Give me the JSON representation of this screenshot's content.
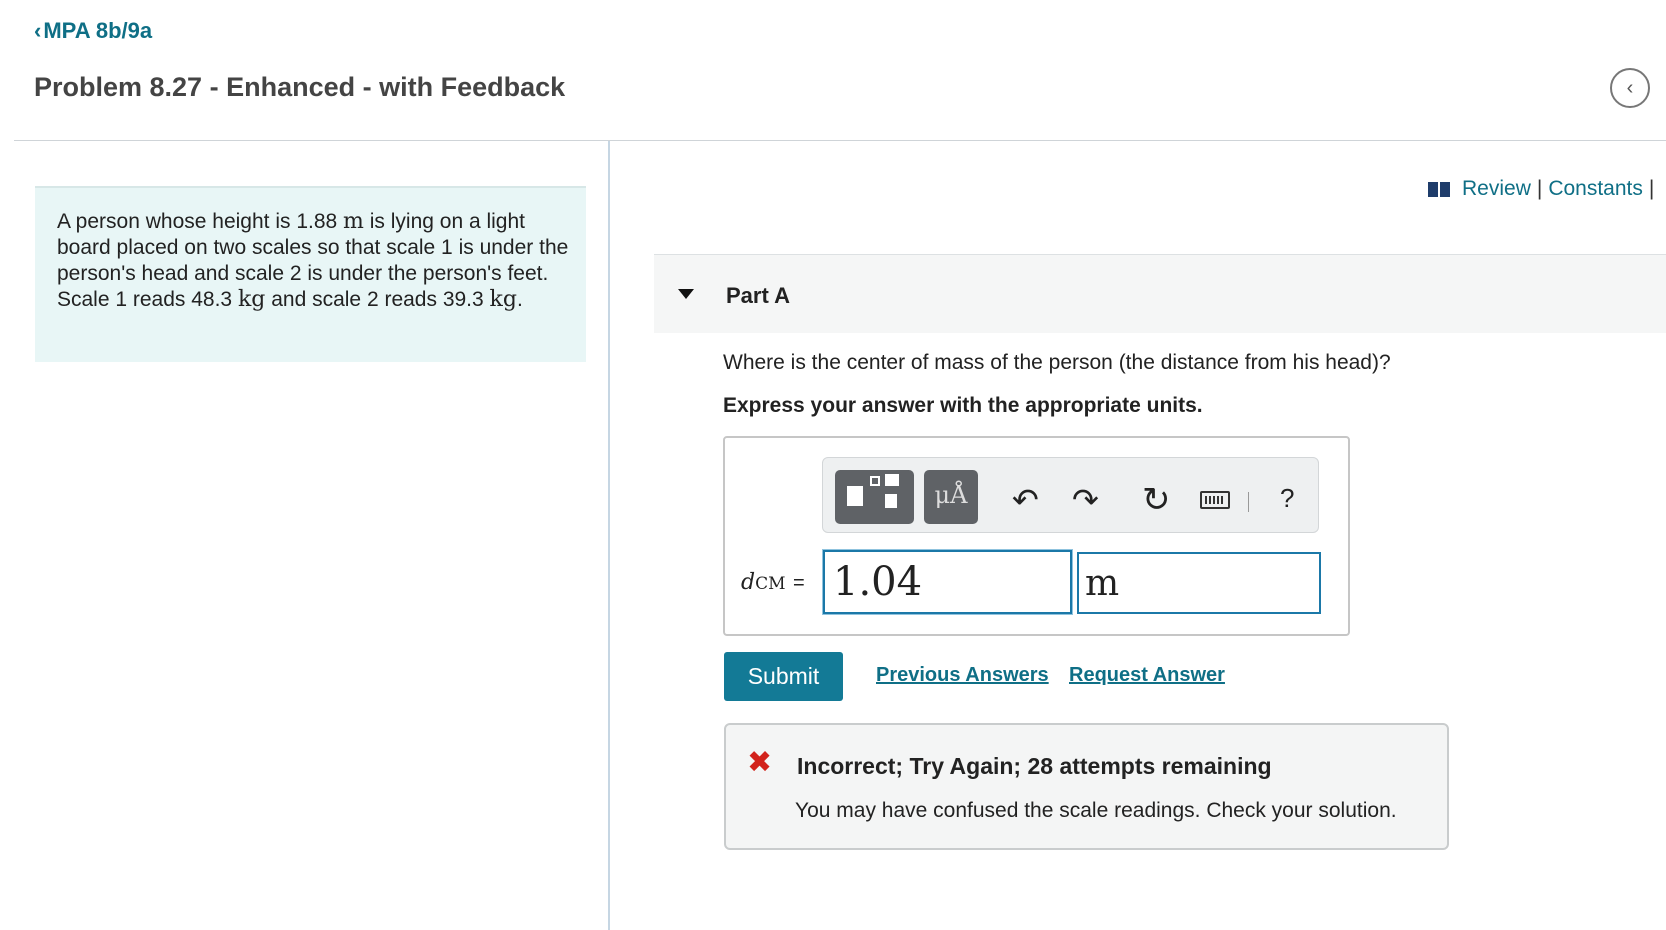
{
  "header": {
    "back_label": "MPA 8b/9a",
    "title": "Problem 8.27 - Enhanced - with Feedback",
    "collapse_icon": "chevron-left-icon"
  },
  "problem": {
    "t1": "A person whose height is 1.88 ",
    "u1": "m",
    "t2": " is lying on a light board placed on two scales so that scale 1 is under the person's head and scale 2 is under the person's feet. Scale 1 reads 48.3 ",
    "u2": "kg",
    "t3": " and scale 2 reads 39.3 ",
    "u3": "kg",
    "t4": "."
  },
  "links": {
    "review": "Review",
    "separator": "|",
    "constants": "Constants",
    "trailing": "|"
  },
  "part": {
    "label": "Part A",
    "question": "Where is the center of mass of the person (the distance from his head)?",
    "instruction": "Express your answer with the appropriate units."
  },
  "toolbar": {
    "units_label": "μÅ",
    "undo_glyph": "↶",
    "redo_glyph": "↷",
    "reset_glyph": "↻",
    "help_label": "?"
  },
  "answer": {
    "var_main": "d",
    "var_sub": "CM",
    "equals": "=",
    "value": "1.04",
    "unit": "m"
  },
  "actions": {
    "submit": "Submit",
    "previous_answers": "Previous Answers",
    "request_answer": "Request Answer"
  },
  "feedback": {
    "icon": "✖",
    "title": "Incorrect; Try Again; 28 attempts remaining",
    "message": "You may have confused the scale readings. Check your solution."
  },
  "colors": {
    "accent": "#0f6f86",
    "submit_bg": "#137a96",
    "problem_bg": "#e8f6f6",
    "error": "#d2221b"
  }
}
